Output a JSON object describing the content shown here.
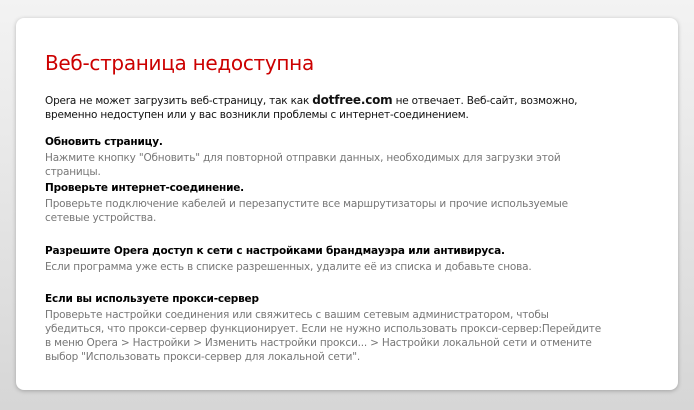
{
  "title": "Веб-страница недоступна",
  "intro": {
    "before": "Opera не может загрузить веб-страницу, так как ",
    "domain": "dotfree.com",
    "after": " не отвечает. Веб-сайт, возможно, временно недоступен или у вас возникли проблемы с интернет-соединением."
  },
  "sections": [
    {
      "heading": "Обновить страницу.",
      "text": "Нажмите кнопку \"Обновить\" для повторной отправки данных, необходимых для загрузки этой страницы."
    },
    {
      "heading": "Проверьте интернет-соединение.",
      "text": "Проверьте подключение кабелей и перезапустите все маршрутизаторы и прочие используемые сетевые устройства."
    },
    {
      "heading": "Разрешите Opera доступ к сети с настройками брандмауэра или антивируса.",
      "text": "Если программа уже есть в списке разрешенных, удалите её из списка и добавьте снова."
    },
    {
      "heading": "Если вы используете прокси-сервер",
      "text": "Проверьте настройки соединения или свяжитесь с вашим сетевым администратором, чтобы убедиться, что прокси-сервер функционирует. Если не нужно использовать прокси-сервер:Перейдите в меню Opera > Настройки > Изменить настройки прокси... > Настройки локальной сети и отмените выбор \"Использовать прокси-сервер для локальной сети\"."
    }
  ]
}
